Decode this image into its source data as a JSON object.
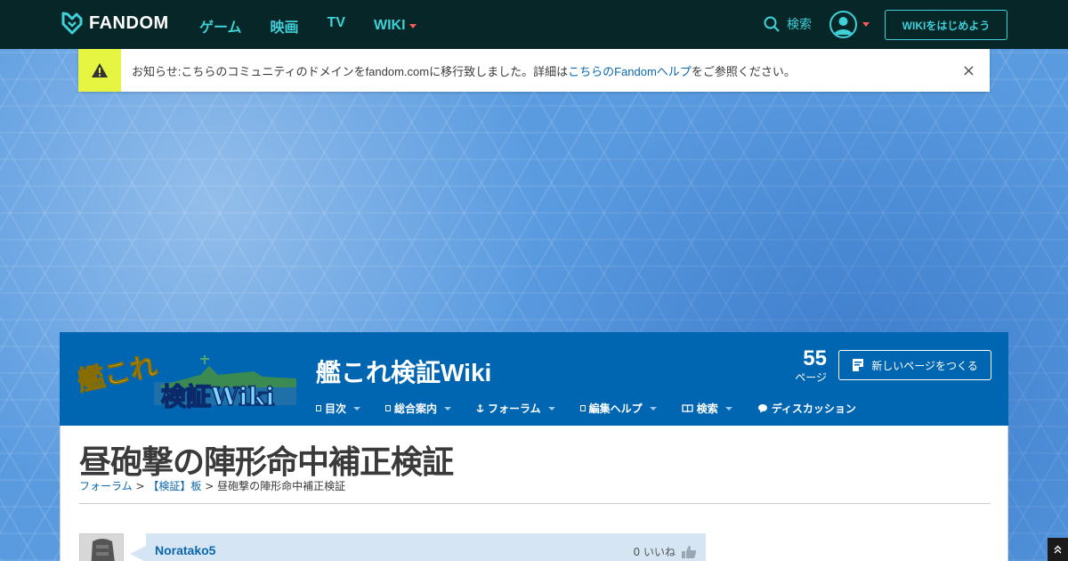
{
  "topnav": {
    "brand": "FANDOM",
    "links": [
      "ゲーム",
      "映画",
      "TV"
    ],
    "wiki_label": "WIKI",
    "search_label": "検索",
    "start_wiki_label": "WIKIをはじめよう"
  },
  "notice": {
    "text_before": "お知らせ:こちらのコミュニティのドメインをfandom.comに移行致しました。詳細は",
    "link_text": "こちらのFandomヘルプ",
    "text_after": "をご参照ください。",
    "close": "×"
  },
  "wiki": {
    "title": "艦これ検証Wiki",
    "page_count": "55",
    "page_count_label": "ページ",
    "new_page_label": "新しいページをつくる",
    "logo_text_top": "艦これ",
    "logo_text_bottom": "検証Wiki",
    "nav": [
      {
        "label": "目次",
        "icon": "square-icon"
      },
      {
        "label": "総合案内",
        "icon": "square-icon"
      },
      {
        "label": "フォーラム",
        "icon": "anchor-icon"
      },
      {
        "label": "編集ヘルプ",
        "icon": "square-icon"
      },
      {
        "label": "検索",
        "icon": "book-icon"
      },
      {
        "label": "ディスカッション",
        "icon": "speech-bubble-icon"
      }
    ]
  },
  "page": {
    "title": "昼砲撃の陣形命中補正検証",
    "breadcrumb": {
      "crumb1": "フォーラム",
      "sep": ">",
      "crumb2": "【検証】板",
      "current": "昼砲撃の陣形命中補正検証"
    }
  },
  "post": {
    "author": "Noratako5",
    "likes": "0 いいね"
  },
  "colors": {
    "topnav_bg": "#062628",
    "accent": "#3fd0d8",
    "wiki_header": "#0166b2",
    "notice_icon_bg": "#e6f542",
    "link": "#0b67ad"
  }
}
